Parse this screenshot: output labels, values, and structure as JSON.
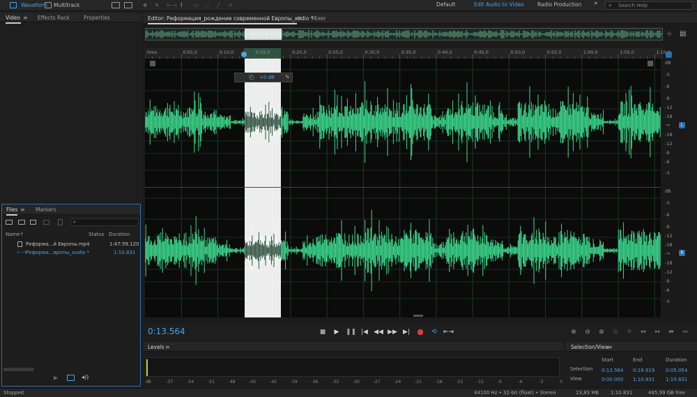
{
  "topbar": {
    "waveform_label": "Waveform",
    "multitrack_label": "Multitrack",
    "workspaces": [
      "Default",
      "Edit Audio to Video",
      "Radio Production"
    ],
    "overflow": "»",
    "search_placeholder": "Search Help",
    "accent": "#4aa3e8"
  },
  "left_panel": {
    "tabs": [
      "Video",
      "Effects Rack",
      "Properties"
    ]
  },
  "files_panel": {
    "tabs": [
      "Files",
      "Markers"
    ],
    "columns": {
      "name": "Name",
      "status": "Status",
      "duration": "Duration"
    },
    "sort_glyph": "↑",
    "rows": [
      {
        "name": "Реформа...й Европы.mp4",
        "duration": "1:47:59.120",
        "selected": false
      },
      {
        "name": "Реформа...вропы_audio *",
        "duration": "1:10.831",
        "selected": true
      }
    ]
  },
  "editor": {
    "tab_label": "Editor: Реформация_рождение современной Европы_audio *",
    "mixer_label": "Mixer",
    "ruler_unit": "hms",
    "ruler_ticks": [
      "0:05,0",
      "0:10,0",
      "0:15,0",
      "0:20,0",
      "0:25,0",
      "0:30,0",
      "0:35,0",
      "0:40,0",
      "0:45,0",
      "0:50,0",
      "0:55,0",
      "1:00,0",
      "1:05,0",
      "1:10,0"
    ],
    "hud_gain": "+0 dB",
    "db_scale": [
      "dB",
      "-3",
      "-6",
      "-9",
      "-12",
      "-18",
      "-∞",
      "-18",
      "-12",
      "-9",
      "-6",
      "-3"
    ],
    "channel_left": "L",
    "channel_right": "R",
    "wave_color": "#3ddc8f",
    "selection": {
      "start_sec": 13.564,
      "end_sec": 18.619,
      "total_sec": 70.831
    }
  },
  "transport": {
    "timecode": "0:13.564"
  },
  "levels": {
    "title": "Levels",
    "scale": [
      "dB",
      "-57",
      "-54",
      "-51",
      "-48",
      "-45",
      "-42",
      "-39",
      "-36",
      "-33",
      "-30",
      "-27",
      "-24",
      "-21",
      "-18",
      "-15",
      "-12",
      "-9",
      "-6",
      "-3",
      "0"
    ]
  },
  "selection_view": {
    "title": "Selection/View",
    "headers": [
      "Start",
      "End",
      "Duration"
    ],
    "rows": [
      {
        "label": "Selection",
        "start": "0:13.564",
        "end": "0:18.619",
        "duration": "0:05.054"
      },
      {
        "label": "View",
        "start": "0:00.000",
        "end": "1:10.831",
        "duration": "1:10.831"
      }
    ]
  },
  "statusbar": {
    "state": "Stopped",
    "format": "44100 Hz • 32-bit (float) • Stereo",
    "size": "23,83 MB",
    "duration": "1:10.831",
    "free": "485,99 GB free"
  }
}
